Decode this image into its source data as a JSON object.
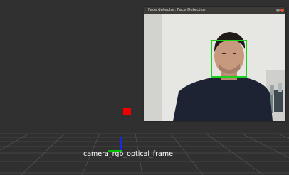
{
  "face_window": {
    "title": "Face detector: Face Detection",
    "minimize_icon": "minimize-icon",
    "close_icon": "close-icon"
  },
  "scene": {
    "frame_label": "camera_rgb_optical_frame"
  },
  "colors": {
    "viewport_bg": "#303030",
    "grid_lines": "#5a5a5a",
    "face_box": "#1dd21d",
    "marker": "#ee0000",
    "axis_z": "#1a28d8",
    "axis_y": "#00c000"
  }
}
